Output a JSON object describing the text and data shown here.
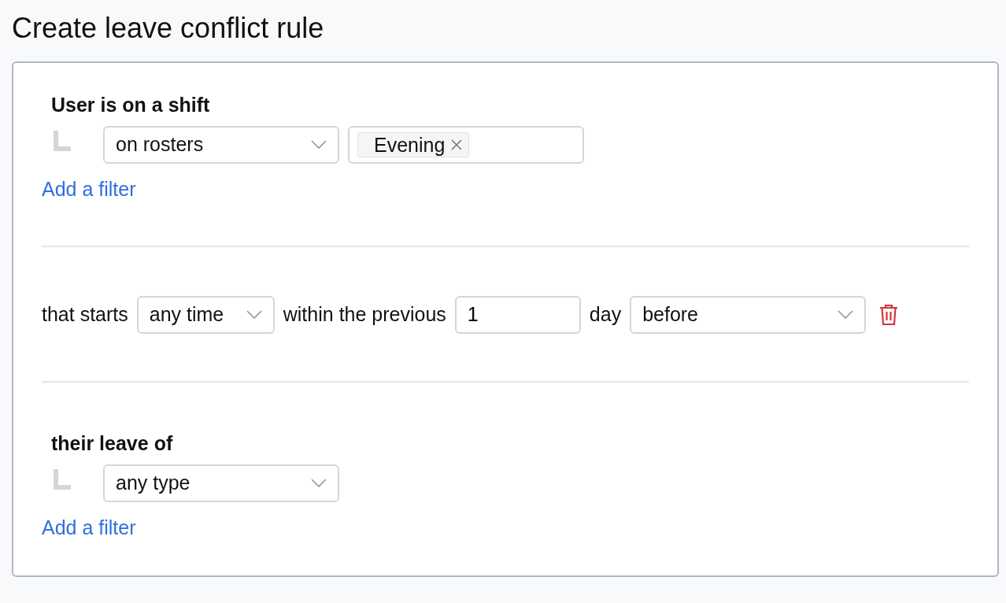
{
  "title": "Create leave conflict rule",
  "sections": [
    {
      "kind": "group",
      "heading": "User is on a shift",
      "filters": [
        {
          "select": "on rosters",
          "tags": [
            "Evening"
          ]
        }
      ],
      "add_link": "Add a filter"
    },
    {
      "kind": "condition",
      "parts": [
        {
          "kind": "text",
          "text": "that starts"
        },
        {
          "kind": "select",
          "value": "any time"
        },
        {
          "kind": "text",
          "text": "within the previous"
        },
        {
          "kind": "input",
          "value": "1"
        },
        {
          "kind": "text",
          "text": "day"
        },
        {
          "kind": "select",
          "value": "before"
        },
        {
          "kind": "delete"
        }
      ]
    },
    {
      "kind": "group",
      "heading": "their leave of",
      "filters": [
        {
          "select": "any type"
        }
      ],
      "add_link": "Add a filter"
    }
  ]
}
